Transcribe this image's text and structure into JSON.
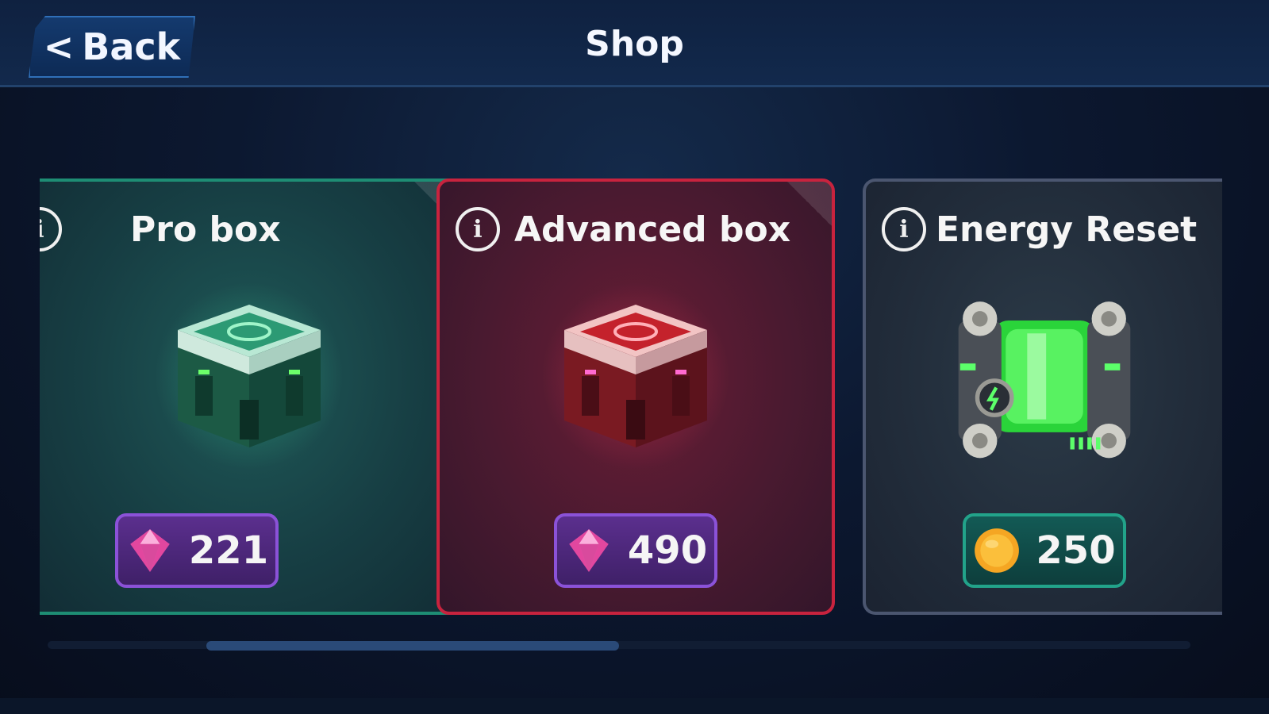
{
  "header": {
    "back_label": "Back",
    "back_chevron": "<",
    "title": "Shop"
  },
  "cards": [
    {
      "title": "Pro box",
      "info": "i",
      "item_icon": "pro-loot-box",
      "price": "221",
      "currency": "gem",
      "accent": "#1e8d74"
    },
    {
      "title": "Advanced box",
      "info": "i",
      "item_icon": "advanced-loot-box",
      "price": "490",
      "currency": "gem",
      "accent": "#c8233e"
    },
    {
      "title": "Energy Reset",
      "info": "i",
      "item_icon": "energy-cell",
      "price": "250",
      "currency": "coin",
      "accent": "#4b5670"
    }
  ],
  "colors": {
    "gem": "#e2479f",
    "coin": "#f5a623",
    "energy_glow": "#3fe24b"
  }
}
